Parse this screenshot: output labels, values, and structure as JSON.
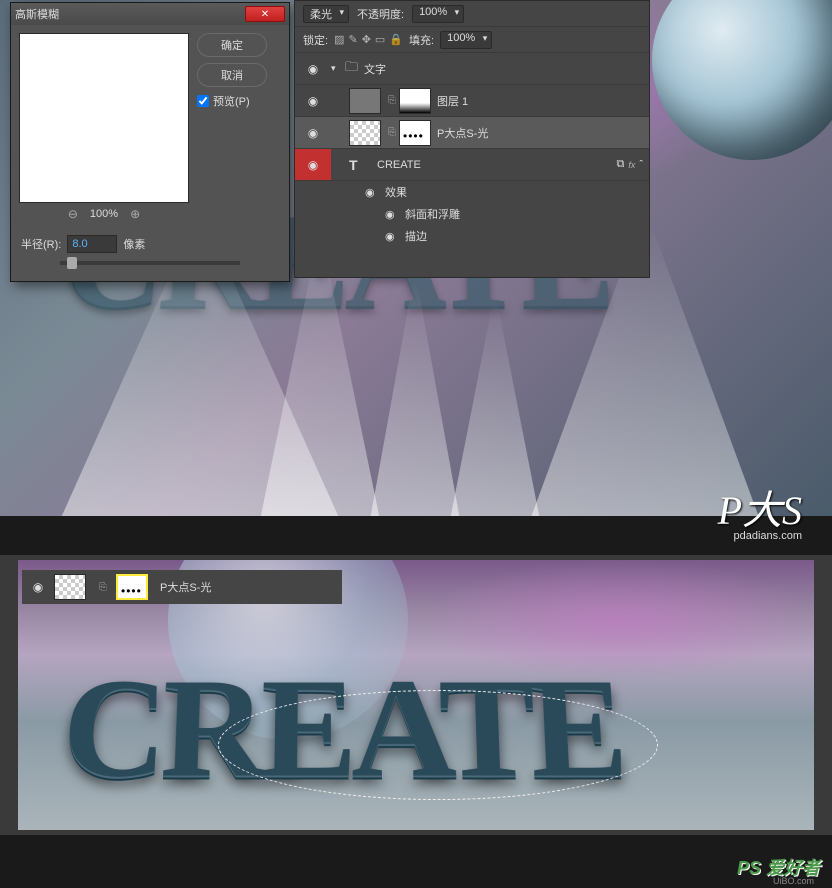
{
  "dialog": {
    "title": "高斯模糊",
    "ok": "确定",
    "cancel": "取消",
    "preview_label": "预览(P)",
    "zoom": "100%",
    "radius_label": "半径(R):",
    "radius_value": "8.0",
    "radius_unit": "像素"
  },
  "layers": {
    "blend_mode": "柔光",
    "opacity_label": "不透明度:",
    "opacity_value": "100%",
    "lock_label": "锁定:",
    "fill_label": "填充:",
    "fill_value": "100%",
    "items": [
      {
        "name": "文字",
        "type": "folder"
      },
      {
        "name": "图层 1",
        "type": "raster"
      },
      {
        "name": "P大点S-光",
        "type": "raster",
        "selected": true
      },
      {
        "name": "CREATE",
        "type": "text",
        "fx": true
      }
    ],
    "effects_label": "效果",
    "effects": [
      "斜面和浮雕",
      "描边"
    ]
  },
  "bottom_layer": {
    "name": "P大点S-光"
  },
  "artwork_text": "CREATE",
  "watermark": {
    "main": "P大S",
    "sub": "pdadians.com"
  },
  "footer": {
    "main": "PS 爱好者",
    "sub": "UiBO.com"
  }
}
